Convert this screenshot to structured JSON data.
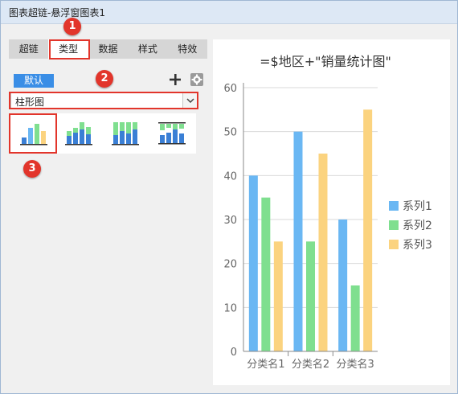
{
  "window": {
    "title": "图表超链-悬浮窗图表1"
  },
  "tabs": [
    {
      "label": "超链",
      "active": false
    },
    {
      "label": "类型",
      "active": true
    },
    {
      "label": "数据",
      "active": false
    },
    {
      "label": "样式",
      "active": false
    },
    {
      "label": "特效",
      "active": false
    }
  ],
  "toolbar": {
    "default_label": "默认",
    "add_icon": "plus-icon",
    "settings_icon": "gear-icon"
  },
  "chart_type_select": {
    "value": "柱形图"
  },
  "chart_styles": [
    "clustered-column",
    "stacked-column",
    "percent-stacked-column",
    "bidirectional-column"
  ],
  "annotations": [
    "1",
    "2",
    "3"
  ],
  "colors": {
    "accent": "#3a8ee6",
    "annotation_red": "#e2352b",
    "series1": "#6ab7f3",
    "series2": "#7fdf8f",
    "series3": "#fbd37f"
  },
  "chart_data": {
    "type": "bar",
    "title": "=$地区+\"销量统计图\"",
    "categories": [
      "分类名1",
      "分类名2",
      "分类名3"
    ],
    "series": [
      {
        "name": "系列1",
        "values": [
          40,
          50,
          30
        ]
      },
      {
        "name": "系列2",
        "values": [
          35,
          25,
          15
        ]
      },
      {
        "name": "系列3",
        "values": [
          25,
          45,
          55
        ]
      }
    ],
    "yticks": [
      "0",
      "10",
      "20",
      "30",
      "40",
      "50",
      "60"
    ],
    "ylim": [
      0,
      60
    ],
    "grid": true,
    "legend": "right"
  }
}
